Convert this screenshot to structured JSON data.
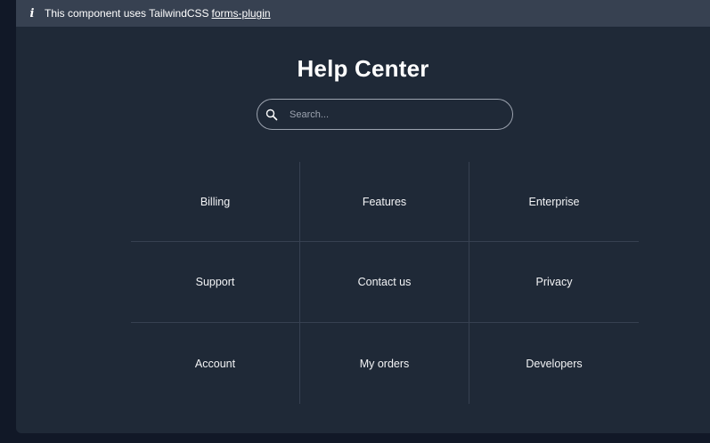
{
  "notice": {
    "text": "This component uses TailwindCSS",
    "link": "forms-plugin"
  },
  "page": {
    "title": "Help Center"
  },
  "search": {
    "placeholder": "Search..."
  },
  "categories": [
    "Billing",
    "Features",
    "Enterprise",
    "Support",
    "Contact us",
    "Privacy",
    "Account",
    "My orders",
    "Developers"
  ],
  "colors": {
    "page_bg": "#111827",
    "panel_bg": "#1f2937",
    "notice_bg": "#374151",
    "divider": "#374151",
    "search_border": "#9ca3af"
  }
}
